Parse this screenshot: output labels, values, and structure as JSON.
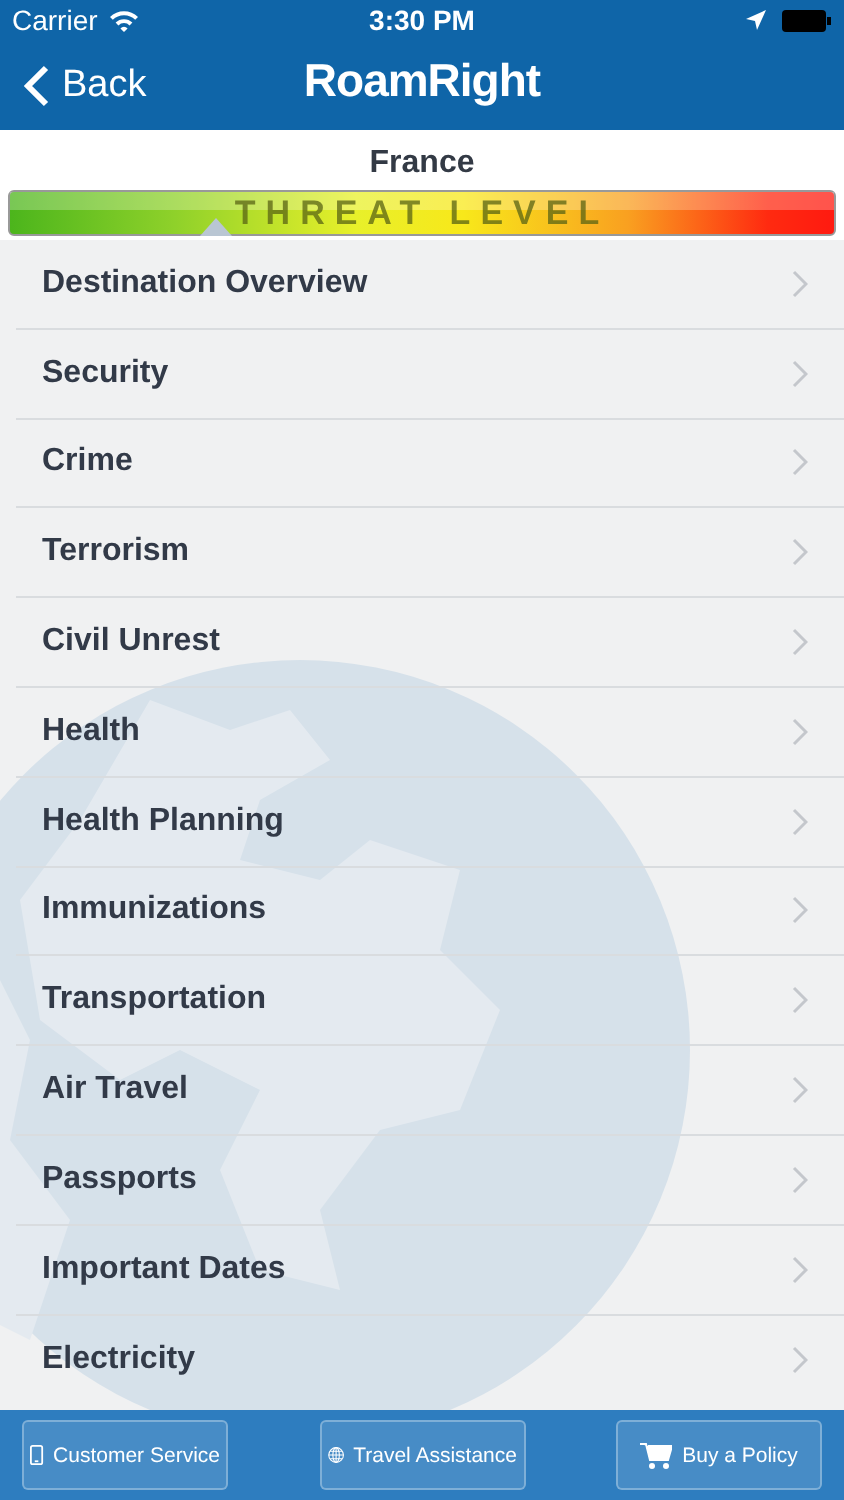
{
  "status_bar": {
    "carrier": "Carrier",
    "time": "3:30 PM"
  },
  "nav": {
    "back": "Back",
    "logo": "RoamRight"
  },
  "threat": {
    "country": "France",
    "label": "THREAT LEVEL",
    "level": 0.25
  },
  "menu": [
    {
      "label": "Destination Overview"
    },
    {
      "label": "Security"
    },
    {
      "label": "Crime"
    },
    {
      "label": "Terrorism"
    },
    {
      "label": "Civil Unrest"
    },
    {
      "label": "Health"
    },
    {
      "label": "Health Planning"
    },
    {
      "label": "Immunizations"
    },
    {
      "label": "Transportation"
    },
    {
      "label": "Air Travel"
    },
    {
      "label": "Passports"
    },
    {
      "label": "Important Dates"
    },
    {
      "label": "Electricity"
    }
  ],
  "toolbar": [
    {
      "kind": "phone",
      "label": "Customer Service"
    },
    {
      "kind": "globe",
      "label": "Travel Assistance"
    },
    {
      "kind": "cart",
      "label": "Buy a Policy"
    }
  ]
}
